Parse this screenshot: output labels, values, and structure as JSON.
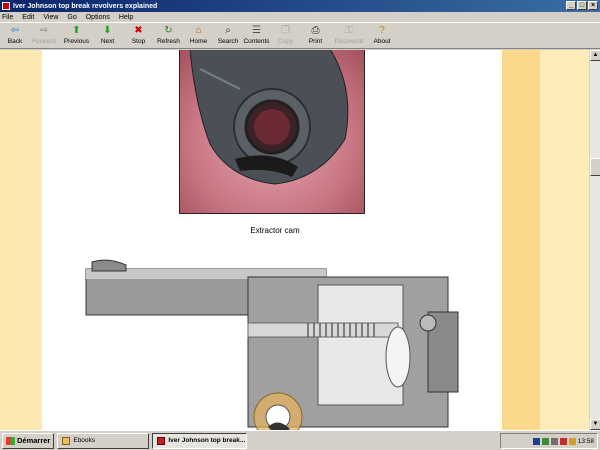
{
  "window": {
    "title": "Iver Johnson top break revolvers explained",
    "buttons": {
      "minimize": "_",
      "maximize": "□",
      "close": "×"
    }
  },
  "menu": [
    "File",
    "Edit",
    "View",
    "Go",
    "Options",
    "Help"
  ],
  "toolbar": [
    {
      "label": "Back",
      "icon": "back-arrow-icon",
      "glyph": "⇦",
      "color": "#1e7bd0",
      "enabled": true
    },
    {
      "label": "Forward",
      "icon": "forward-arrow-icon",
      "glyph": "⇨",
      "color": "#808080",
      "enabled": false
    },
    {
      "label": "Previous",
      "icon": "up-arrow-icon",
      "glyph": "⬆",
      "color": "#18a018",
      "enabled": true
    },
    {
      "label": "Next",
      "icon": "down-arrow-icon",
      "glyph": "⬇",
      "color": "#18a018",
      "enabled": true
    },
    {
      "label": "Stop",
      "icon": "stop-icon",
      "glyph": "✖",
      "color": "#d00000",
      "enabled": true
    },
    {
      "label": "Refresh",
      "icon": "refresh-icon",
      "glyph": "↻",
      "color": "#308030",
      "enabled": true
    },
    {
      "label": "Home",
      "icon": "home-icon",
      "glyph": "⌂",
      "color": "#a06020",
      "enabled": true
    },
    {
      "label": "Search",
      "icon": "search-icon",
      "glyph": "⌕",
      "color": "#303030",
      "enabled": true
    },
    {
      "label": "Contents",
      "icon": "contents-icon",
      "glyph": "☰",
      "color": "#505050",
      "enabled": true
    },
    {
      "label": "Copy",
      "icon": "copy-icon",
      "glyph": "❐",
      "color": "#a8a8a8",
      "enabled": false
    },
    {
      "label": "Print",
      "icon": "print-icon",
      "glyph": "⎙",
      "color": "#303030",
      "enabled": true
    },
    {
      "label": "Password",
      "icon": "password-icon",
      "glyph": "⚿",
      "color": "#a8a8a8",
      "enabled": false
    },
    {
      "label": "About",
      "icon": "about-icon",
      "glyph": "?",
      "color": "#c09000",
      "enabled": true
    }
  ],
  "content": {
    "caption": "Extractor cam"
  },
  "colors": {
    "margin_left": "#fce9b0",
    "margin_right": "#fcd98a",
    "titlebar": "#0a246a"
  },
  "taskbar": {
    "start": "Démarrer",
    "tasks": [
      {
        "label": "Ebooks",
        "active": false
      },
      {
        "label": "Iver Johnson top break...",
        "active": true
      }
    ],
    "clock": "13:58"
  }
}
